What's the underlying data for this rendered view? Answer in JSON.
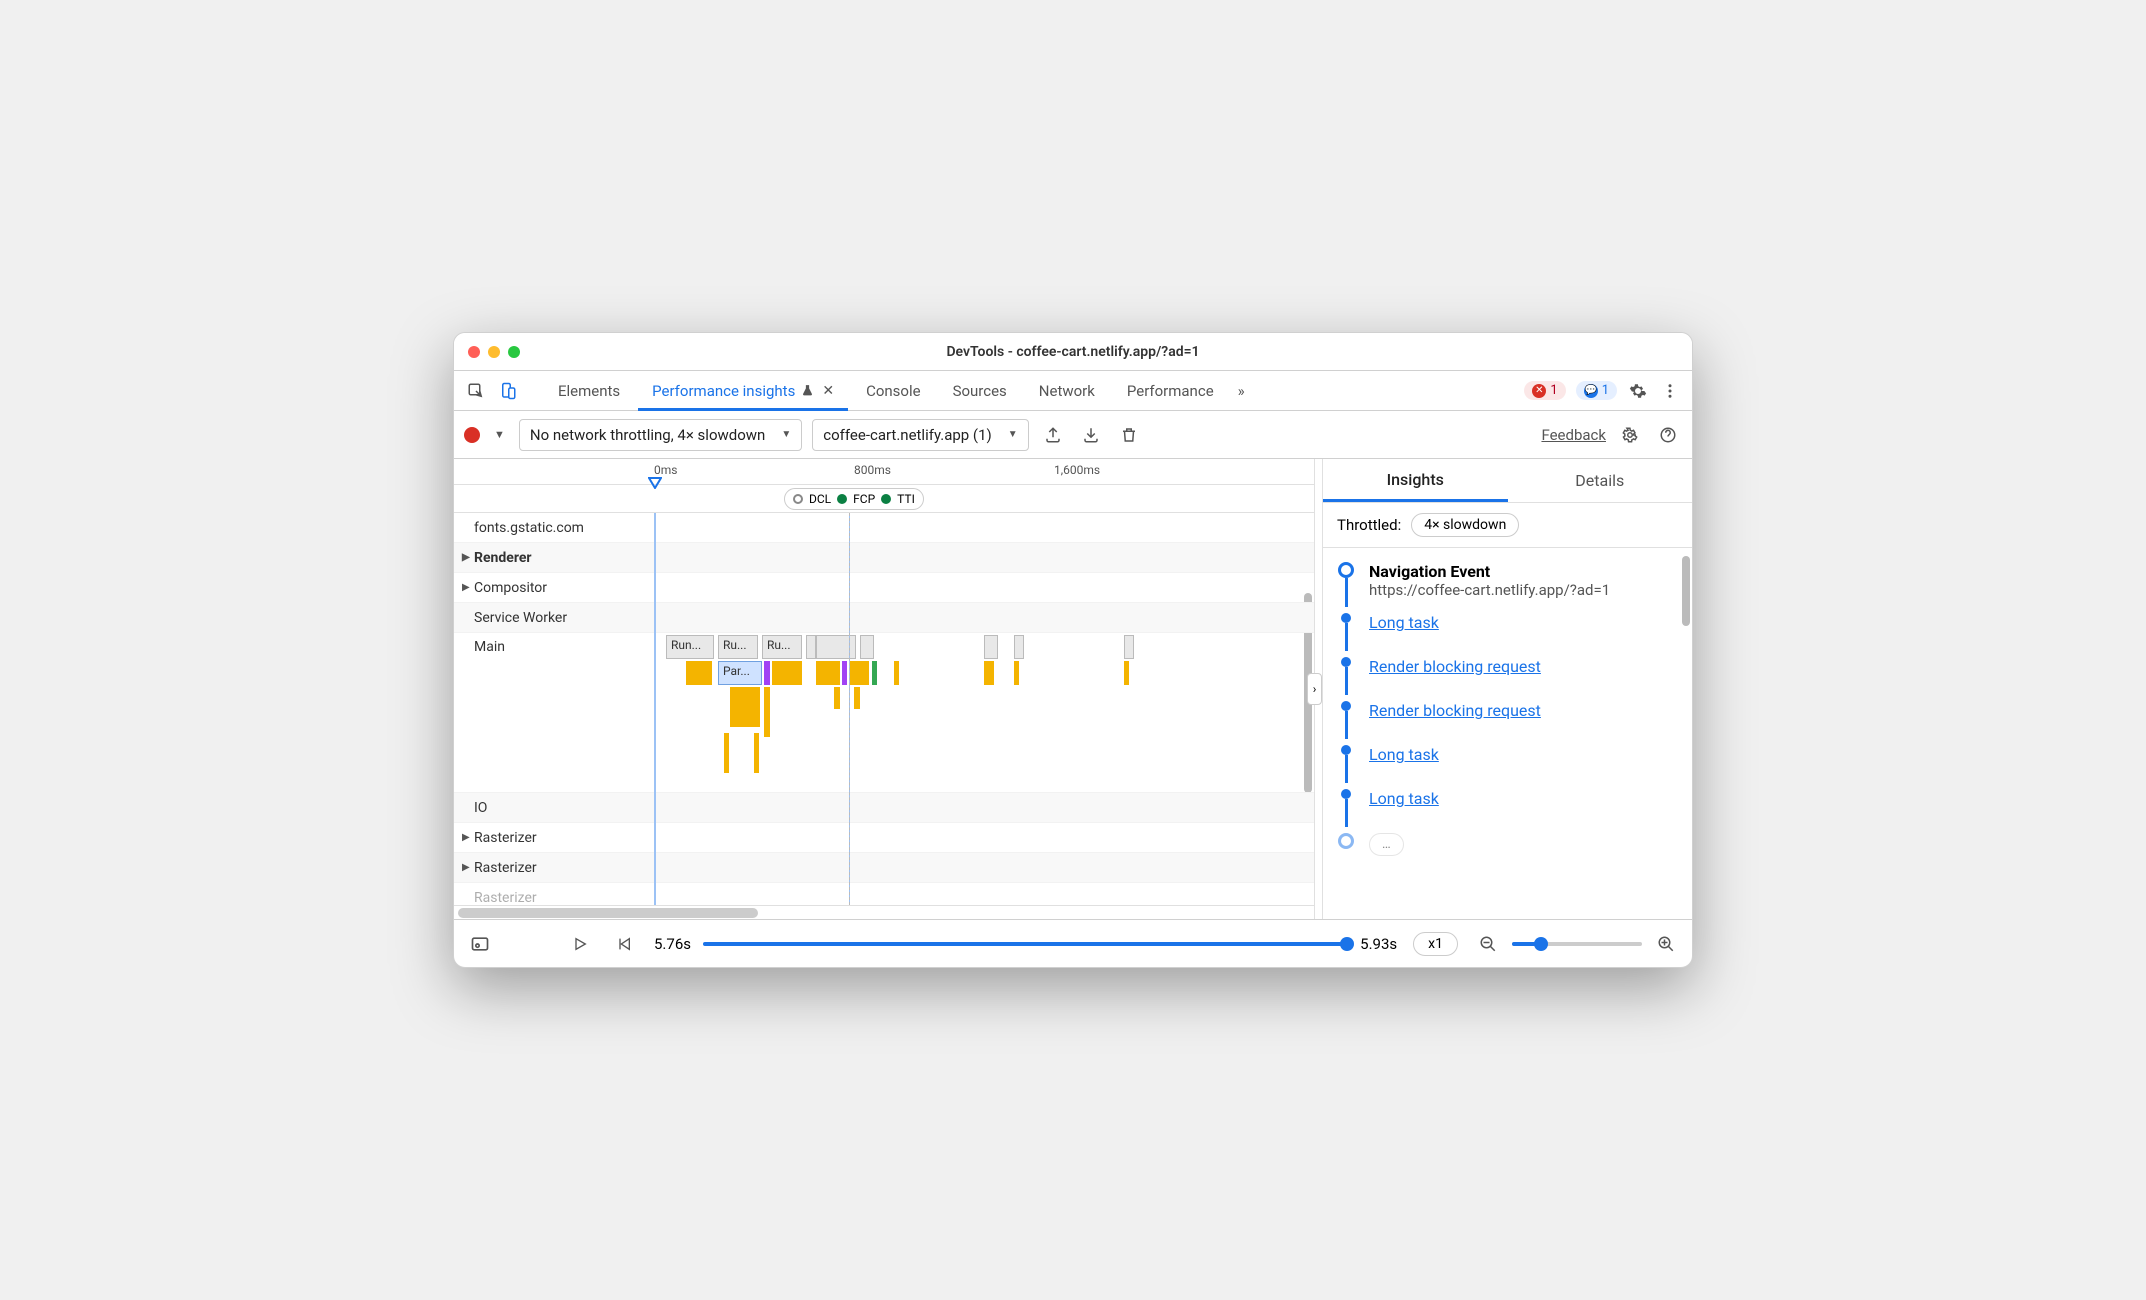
{
  "window": {
    "title": "DevTools - coffee-cart.netlify.app/?ad=1"
  },
  "tabs": {
    "items": [
      "Elements",
      "Performance insights",
      "Console",
      "Sources",
      "Network",
      "Performance"
    ],
    "active_index": 1,
    "overflow_glyph": "»",
    "error_count": "1",
    "message_count": "1"
  },
  "toolbar": {
    "throttle_select": "No network throttling, 4× slowdown",
    "page_select": "coffee-cart.netlify.app (1)",
    "feedback": "Feedback"
  },
  "ruler": {
    "ticks": [
      "0ms",
      "800ms",
      "1,600ms"
    ]
  },
  "markers": {
    "dcl": "DCL",
    "fcp": "FCP",
    "tti": "TTI"
  },
  "tracks": {
    "rows": [
      "fonts.gstatic.com",
      "Renderer",
      "Compositor",
      "Service Worker",
      "Main",
      "IO",
      "Rasterizer",
      "Rasterizer",
      "Rasterizer"
    ],
    "tasks": {
      "run": "Run...",
      "run2": "Ru...",
      "run3": "Ru...",
      "parse": "Par..."
    }
  },
  "insights": {
    "tabs": {
      "insights": "Insights",
      "details": "Details"
    },
    "throttled_label": "Throttled:",
    "throttled_value": "4× slowdown",
    "nav_event": {
      "title": "Navigation Event",
      "url": "https://coffee-cart.netlify.app/?ad=1"
    },
    "items": [
      "Long task",
      "Render blocking request",
      "Render blocking request",
      "Long task",
      "Long task"
    ]
  },
  "bottom": {
    "time_start": "5.76s",
    "time_end": "5.93s",
    "zoom_label": "x1"
  }
}
